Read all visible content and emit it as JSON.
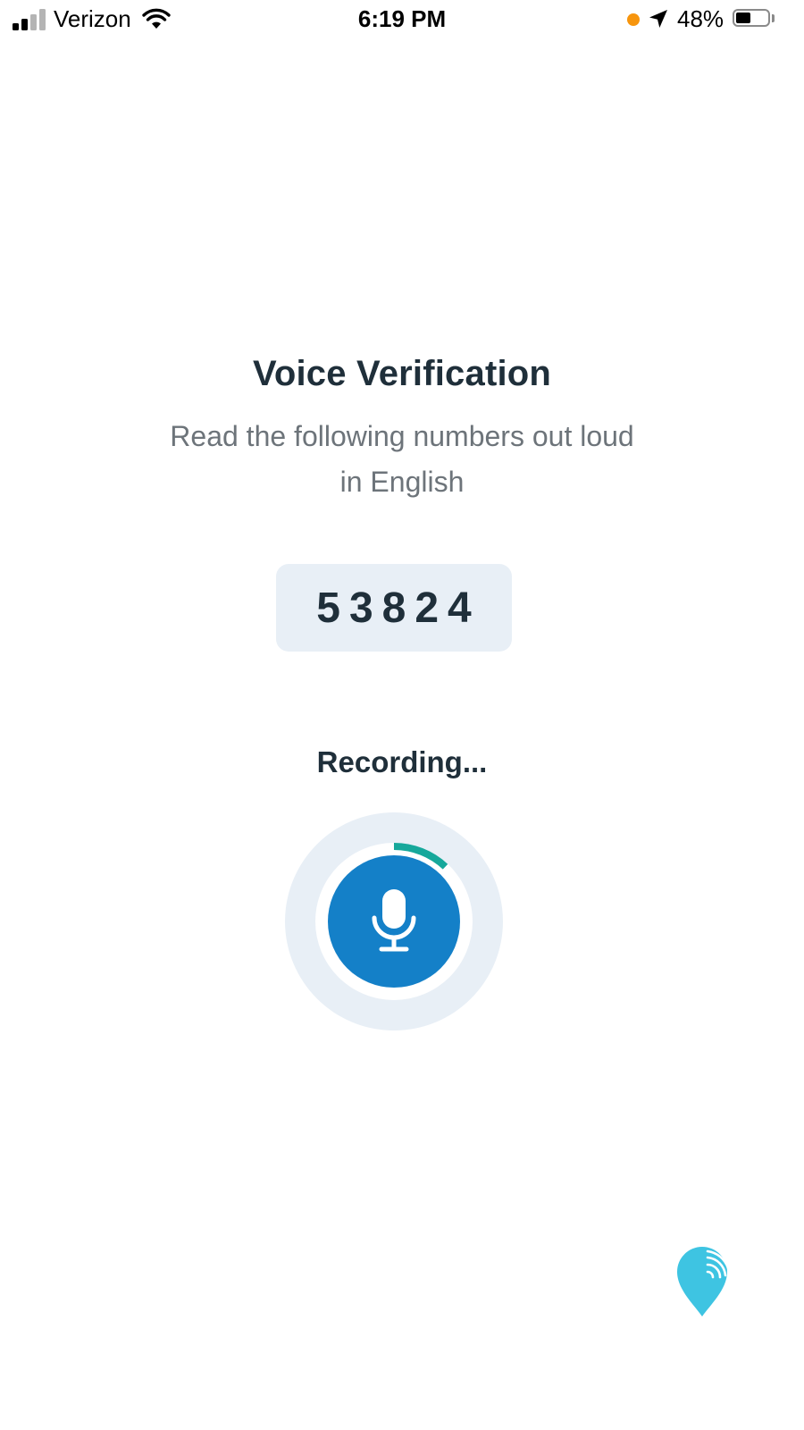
{
  "status_bar": {
    "carrier": "Verizon",
    "time": "6:19 PM",
    "battery_percent": "48%",
    "battery_level": 0.48,
    "signal_bars_active": 2,
    "signal_bars_total": 4,
    "icons": [
      "signal-icon",
      "wifi-icon",
      "recording-indicator",
      "location-arrow-icon",
      "battery-icon"
    ]
  },
  "page": {
    "title": "Voice Verification",
    "instructions_line1": "Read the following numbers out loud",
    "instructions_line2": "in English",
    "digits": "53824",
    "status": "Recording..."
  },
  "mic": {
    "icon": "microphone-icon",
    "progress": 0.12
  },
  "colors": {
    "text_primary": "#1f2f3a",
    "text_secondary": "#6d747a",
    "panel_bg": "#e8eff6",
    "mic_blue": "#1480c8",
    "progress_teal": "#16a89b",
    "logo_cyan": "#3ec4e2",
    "recording_orange": "#f7950d"
  },
  "brand": {
    "icon": "location-pin-logo"
  }
}
